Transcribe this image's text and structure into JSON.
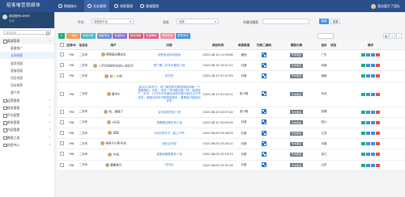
{
  "app": {
    "title": "招客喵营销媒体"
  },
  "topnav": [
    {
      "label": "数据统计",
      "active": false
    },
    {
      "label": "业务管理",
      "active": true
    },
    {
      "label": "线索管理",
      "active": false
    },
    {
      "label": "客服管理",
      "active": false
    }
  ],
  "user": {
    "name": "我也要开了团队"
  },
  "profile": {
    "name": "测试账号18999",
    "status": "在线"
  },
  "sidebar": {
    "search_placeholder": "搜索菜单",
    "items": [
      {
        "label": "渠道管理",
        "level": 0,
        "active": false,
        "open": true,
        "arrow": "∨"
      },
      {
        "label": "渠道推广",
        "level": 1,
        "active": false
      },
      {
        "label": "全网线索",
        "level": 1,
        "active": true
      },
      {
        "label": "留资线索",
        "level": 1,
        "active": false
      },
      {
        "label": "客服线索",
        "level": 1,
        "active": false
      },
      {
        "label": "项目线索",
        "level": 1,
        "active": false
      },
      {
        "label": "回访推荐",
        "level": 1,
        "active": false
      },
      {
        "label": "客户库",
        "level": 1,
        "active": false
      },
      {
        "label": "运营管理",
        "level": 0,
        "active": false,
        "arrow": "<"
      },
      {
        "label": "财务管理",
        "level": 0,
        "active": false,
        "arrow": "<"
      },
      {
        "label": "平台配置",
        "level": 0,
        "active": false,
        "arrow": "<"
      },
      {
        "label": "系统管理",
        "level": 0,
        "active": false,
        "arrow": "<"
      },
      {
        "label": "内容管理",
        "level": 0,
        "active": false,
        "arrow": "<"
      },
      {
        "label": "数据工具",
        "level": 0,
        "active": false,
        "arrow": "<"
      },
      {
        "label": "消息中心",
        "level": 0,
        "active": false,
        "arrow": "<"
      }
    ]
  },
  "filters": {
    "platform_label": "平台",
    "platform_value": "请选择平台",
    "status_label": "状态",
    "status_value": "选择",
    "keyword_label": "关键词搜索",
    "search_button": "搜索",
    "reset_button": "重置"
  },
  "toolbar": {
    "buttons": [
      {
        "label": "↻",
        "color": "#18b07b"
      },
      {
        "label": "+ 添加",
        "color": "#f29b4b"
      },
      {
        "label": "批量分配",
        "color": "#3fb8c8"
      },
      {
        "label": "批量导出",
        "color": "#6c8fd9"
      },
      {
        "label": "批量标记",
        "color": "#8a6fd6"
      },
      {
        "label": "回收线索",
        "color": "#d95a75"
      },
      {
        "label": "批量删除",
        "color": "#e7598a"
      },
      {
        "label": "清空回收",
        "color": "#f2889b"
      },
      {
        "label": "更多操作",
        "color": "#4a90e2"
      }
    ]
  },
  "table": {
    "columns": [
      "",
      "应用ID",
      "信息名",
      "用户",
      "内容",
      "添加时间",
      "来源渠道",
      "扫码二维码",
      "跟踪记录",
      "省份",
      "状态",
      "操作"
    ],
    "rows": [
      {
        "id": "798",
        "info": "二手车",
        "user": "葡萄园水果店主",
        "content": "请把电话号码报我",
        "time": "2023-08-10 11:59:08",
        "channel": "微信",
        "track": "暂未跟进",
        "region": "广东"
      },
      {
        "id": "798",
        "info": "二手车",
        "user": "二手@品质好车放心 知识点",
        "content": "想了解二手车价格多少钱",
        "time": "2023-08-10 10:47:27",
        "channel": "抖音",
        "track": "暂未跟进",
        "region": "河南"
      },
      {
        "id": "798",
        "info": "二手车",
        "user": "赵✨小明",
        "content": "你在吗",
        "time": "2023-08-10 07:07:59",
        "channel": "抖音",
        "track": "暂未跟进",
        "region": "湖南"
      },
      {
        "id": "798",
        "info": "二手车",
        "user": "唐诗七",
        "content": "我今天3年车子，有了新的购车需求想和你聊一下看看情况，你好，你说一些问题大概一样，我想找个二手车，10万车子价格合适你们能不能在当下先查查，顺便问问车况哪里能看车，看看能不能找到好车",
        "time": "2023-08-10 01:05:21",
        "channel": "多小程",
        "track": "暂未跟进",
        "region": "河北"
      },
      {
        "id": "798",
        "info": "二手车",
        "user": "哈，理想了",
        "content": "买车相关的多少钱",
        "time": "2023-08-10 00:07:44",
        "channel": "多小程",
        "track": "暂未跟进",
        "region": "安徽"
      },
      {
        "id": "798",
        "info": "二手车",
        "user": "A乐彩",
        "content": "想看看这辆车多少钱",
        "time": "2023-08-10 00:05:49",
        "channel": "抖音",
        "track": "暂未跟进",
        "region": "四川"
      },
      {
        "id": "798",
        "info": "二手车",
        "user": "蓝蓝",
        "content": "8月份的车子，能上户吗",
        "time": "2023-08-09 23:56:09",
        "channel": "抖音",
        "track": "暂未跟进",
        "region": "江苏"
      },
      {
        "id": "798",
        "info": "二手车",
        "user": "林阳子小哥-好车",
        "content": "我在买车呢",
        "time": "2023-08-09 23:00:22",
        "channel": "抖音",
        "track": "暂未跟进",
        "region": "河南"
      },
      {
        "id": "798",
        "info": "二手车",
        "user": "牛妞",
        "content": "谢谢我要看看多少钱",
        "time": "2023-08-09 22:50:13",
        "channel": "抖音",
        "track": "暂未跟进",
        "region": "浙江"
      },
      {
        "id": "798",
        "info": "二手车",
        "user": "鹏鹏宝贝",
        "content": "问问价",
        "time": "2023-08-09 22:31:18",
        "channel": "抖音",
        "track": "暂未跟进",
        "region": "山东"
      }
    ]
  }
}
